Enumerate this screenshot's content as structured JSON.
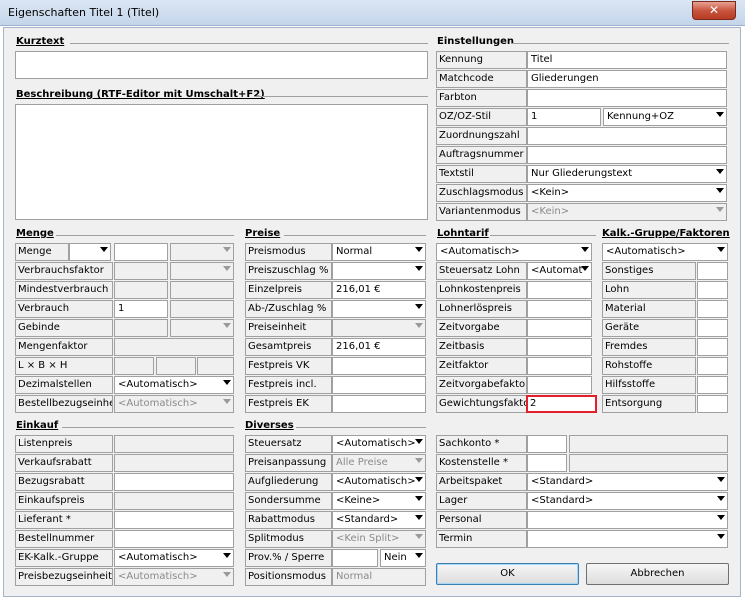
{
  "window": {
    "title": "Eigenschaften Titel 1 (Titel)",
    "close_symbol": "✕"
  },
  "kurztext": {
    "heading": "Kurztext",
    "value": ""
  },
  "beschreibung": {
    "heading": "Beschreibung (RTF-Editor mit Umschalt+F2)",
    "value": ""
  },
  "einstellungen": {
    "heading": "Einstellungen",
    "rows": [
      {
        "label": "Kennung",
        "value": "Titel"
      },
      {
        "label": "Matchcode",
        "value": "Gliederungen"
      },
      {
        "label": "Farbton",
        "value": ""
      },
      {
        "label": "OZ/OZ-Stil",
        "value": "1",
        "style": "Kennung+OZ"
      },
      {
        "label": "Zuordnungszahl",
        "value": ""
      },
      {
        "label": "Auftragsnummer",
        "value": ""
      },
      {
        "label": "Textstil",
        "value": "Nur Gliederungstext"
      },
      {
        "label": "Zuschlagsmodus",
        "value": "<Kein>"
      },
      {
        "label": "Variantenmodus",
        "value": "<Kein>"
      }
    ]
  },
  "menge": {
    "heading": "Menge",
    "rows": [
      {
        "label": "Menge",
        "value": ""
      },
      {
        "label": "Verbrauchsfaktor",
        "value": ""
      },
      {
        "label": "Mindestverbrauch",
        "value": ""
      },
      {
        "label": "Verbrauch",
        "value": "1"
      },
      {
        "label": "Gebinde",
        "value": ""
      },
      {
        "label": "Mengenfaktor",
        "value": ""
      },
      {
        "label": "L × B × H",
        "value": ""
      },
      {
        "label": "Dezimalstellen",
        "value": "<Automatisch>"
      },
      {
        "label": "Bestellbezugseinheit",
        "value": "<Automatisch>"
      }
    ]
  },
  "preise": {
    "heading": "Preise",
    "rows": [
      {
        "label": "Preismodus",
        "value": "Normal"
      },
      {
        "label": "Preiszuschlag %",
        "value": ""
      },
      {
        "label": "Einzelpreis",
        "value": "216,01 €"
      },
      {
        "label": "Ab-/Zuschlag %",
        "value": ""
      },
      {
        "label": "Preiseinheit",
        "value": ""
      },
      {
        "label": "Gesamtpreis",
        "value": "216,01 €"
      },
      {
        "label": "Festpreis VK",
        "value": ""
      },
      {
        "label": "Festpreis incl.",
        "value": ""
      },
      {
        "label": "Festpreis EK",
        "value": ""
      }
    ]
  },
  "lohntarif": {
    "heading": "Lohntarif",
    "select": "<Automatisch>",
    "steuersatz_label": "Steuersatz Lohn",
    "steuersatz_value": "<Automat",
    "rows": [
      {
        "label": "Lohnkostenpreis",
        "value": ""
      },
      {
        "label": "Lohnerlöspreis",
        "value": ""
      },
      {
        "label": "Zeitvorgabe",
        "value": ""
      },
      {
        "label": "Zeitbasis",
        "value": ""
      },
      {
        "label": "Zeitfaktor",
        "value": ""
      },
      {
        "label": "Zeitvorgabefaktor",
        "value": ""
      },
      {
        "label": "Gewichtungsfaktor",
        "value": "2"
      }
    ]
  },
  "kalk": {
    "heading": "Kalk.-Gruppe/Faktoren",
    "select": "<Automatisch>",
    "rows": [
      {
        "label": "Sonstiges",
        "value": ""
      },
      {
        "label": "Lohn",
        "value": ""
      },
      {
        "label": "Material",
        "value": ""
      },
      {
        "label": "Geräte",
        "value": ""
      },
      {
        "label": "Fremdes",
        "value": ""
      },
      {
        "label": "Rohstoffe",
        "value": ""
      },
      {
        "label": "Hilfsstoffe",
        "value": ""
      },
      {
        "label": "Entsorgung",
        "value": ""
      }
    ]
  },
  "einkauf": {
    "heading": "Einkauf",
    "rows": [
      {
        "label": "Listenpreis",
        "value": ""
      },
      {
        "label": "Verkaufsrabatt",
        "value": ""
      },
      {
        "label": "Bezugsrabatt",
        "value": ""
      },
      {
        "label": "Einkaufspreis",
        "value": ""
      },
      {
        "label": "Lieferant *",
        "value": ""
      },
      {
        "label": "Bestellnummer",
        "value": ""
      },
      {
        "label": "EK-Kalk.-Gruppe",
        "value": "<Automatisch>"
      },
      {
        "label": "Preisbezugseinheit",
        "value": "<Automatisch>"
      }
    ]
  },
  "diverses": {
    "heading": "Diverses",
    "rows": [
      {
        "label": "Steuersatz",
        "value": "<Automatisch>"
      },
      {
        "label": "Preisanpassung",
        "value": "Alle Preise"
      },
      {
        "label": "Aufgliederung",
        "value": "<Automatisch>"
      },
      {
        "label": "Sondersumme",
        "value": "<Keine>"
      },
      {
        "label": "Rabattmodus",
        "value": "<Standard>"
      },
      {
        "label": "Splitmodus",
        "value": "<Kein Split>"
      },
      {
        "label": "Prov.% / Sperre",
        "value": "",
        "extra": "Nein"
      },
      {
        "label": "Positionsmodus",
        "value": "Normal"
      }
    ]
  },
  "konten": {
    "rows": [
      {
        "label": "Sachkonto *",
        "value": ""
      },
      {
        "label": "Kostenstelle *",
        "value": ""
      },
      {
        "label": "Arbeitspaket",
        "value": "<Standard>"
      },
      {
        "label": "Lager",
        "value": "<Standard>"
      },
      {
        "label": "Personal",
        "value": ""
      },
      {
        "label": "Termin",
        "value": ""
      }
    ]
  },
  "buttons": {
    "ok": "OK",
    "cancel": "Abbrechen"
  }
}
